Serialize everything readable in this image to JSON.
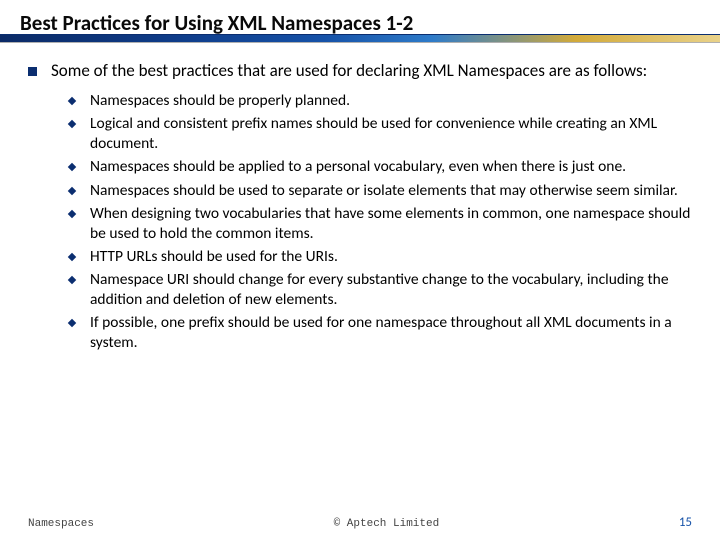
{
  "title": "Best Practices for Using XML Namespaces 1-2",
  "lead": "Some of the best practices that are used for declaring XML Namespaces are as follows:",
  "items": [
    "Namespaces should be properly planned.",
    "Logical and consistent prefix names should be used for convenience while creating an XML document.",
    "Namespaces should be applied to a personal vocabulary, even when there is just one.",
    "Namespaces should be used to separate or isolate elements that may otherwise seem similar.",
    "When designing two vocabularies that have some elements in common, one namespace should be used to hold the common items.",
    "HTTP URLs should be used for the URIs.",
    "Namespace URI should change for every substantive change to the vocabulary, including the addition and deletion of new elements.",
    "If possible, one prefix should be used for one namespace throughout all XML documents in a system."
  ],
  "footer": {
    "left": "Namespaces",
    "center": "© Aptech Limited",
    "page": "15"
  }
}
